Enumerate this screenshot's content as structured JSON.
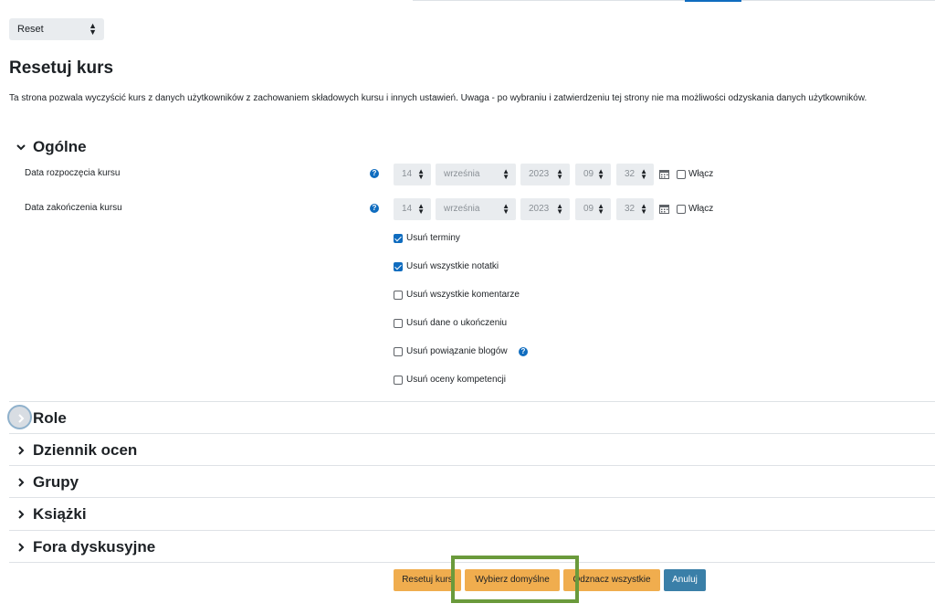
{
  "top_select": {
    "value": "Reset"
  },
  "page": {
    "title": "Resetuj kurs",
    "intro": "Ta strona pozwala wyczyścić kurs z danych użytkowników z zachowaniem składowych kursu i innych ustawień. Uwaga - po wybraniu i zatwierdzeniu tej strony nie ma możliwości odzyskania danych użytkowników."
  },
  "general": {
    "title": "Ogólne",
    "start_date": {
      "label": "Data rozpoczęcia kursu",
      "day": "14",
      "month": "września",
      "year": "2023",
      "hour": "09",
      "minute": "32",
      "enable_label": "Włącz"
    },
    "end_date": {
      "label": "Data zakończenia kursu",
      "day": "14",
      "month": "września",
      "year": "2023",
      "hour": "09",
      "minute": "32",
      "enable_label": "Włącz"
    },
    "options": [
      {
        "label": "Usuń terminy",
        "checked": true
      },
      {
        "label": "Usuń wszystkie notatki",
        "checked": true
      },
      {
        "label": "Usuń wszystkie komentarze",
        "checked": false
      },
      {
        "label": "Usuń dane o ukończeniu",
        "checked": false
      },
      {
        "label": "Usuń powiązanie blogów",
        "checked": false,
        "help": true
      },
      {
        "label": "Usuń oceny kompetencji",
        "checked": false
      }
    ]
  },
  "sections": [
    "Role",
    "Dziennik ocen",
    "Grupy",
    "Książki",
    "Fora dyskusyjne"
  ],
  "buttons": {
    "reset": "Resetuj kurs",
    "defaults": "Wybierz domyślne",
    "deselect": "Odznacz wszystkie",
    "cancel": "Anuluj"
  },
  "icons": {
    "help": "question-circle-icon",
    "calendar": "calendar-icon",
    "chevron_down": "chevron-down-icon",
    "chevron_right": "chevron-right-icon"
  },
  "colors": {
    "primary": "#0f6cbf",
    "button_yellow": "#f0ad4e",
    "button_cancel": "#3a7fa8",
    "highlight": "#6a9a3b"
  }
}
